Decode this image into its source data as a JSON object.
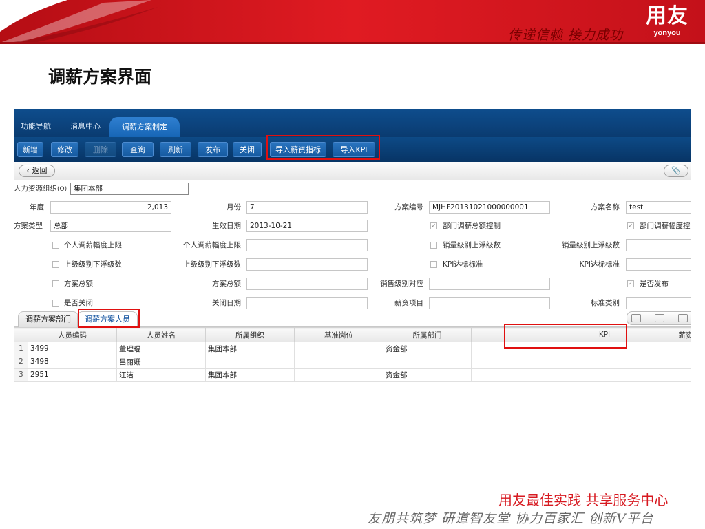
{
  "slide": {
    "slogan": "传递信赖 接力成功",
    "logo_cn": "用友",
    "logo_en": "yonyou",
    "title": "调薪方案界面",
    "footer_red": "用友最佳实践 共享服务中心",
    "footer_script": "友朋共筑梦 研道智友堂 协力百家汇 创新V平台"
  },
  "nav_tabs": [
    "功能导航",
    "消息中心",
    "调薪方案制定"
  ],
  "toolbar": {
    "new": "新增",
    "edit": "修改",
    "delete": "删除",
    "query": "查询",
    "refresh": "刷新",
    "publish": "发布",
    "close": "关闭",
    "import_salary": "导入薪资指标",
    "import_kpi": "导入KPI"
  },
  "subbar": {
    "back": "返回",
    "attach_icon": "paperclip-icon"
  },
  "form": {
    "org_label": "人力资源组织",
    "org_hint": "(O)",
    "org_value": "集团本部",
    "year_label": "年度",
    "year_value": "2,013",
    "month_label": "月份",
    "month_value": "7",
    "code_label": "方案编号",
    "code_value": "MJHF20131021000000001",
    "name_label": "方案名称",
    "name_value": "test",
    "type_label": "方案类型",
    "type_value": "总部",
    "effective_label": "生效日期",
    "effective_value": "2013-10-21",
    "dept_total_ctrl": "部门调薪总额控制",
    "dept_range_ctrl": "部门调薪幅度控制",
    "personal_upper": "个人调薪幅度上限",
    "personal_upper_label": "个人调薪幅度上限",
    "sales_up_float": "销量级别上浮级数",
    "sales_up_float_label": "销量级别上浮级数",
    "superior_down": "上级级别下浮级数",
    "superior_down_label": "上级级别下浮级数",
    "kpi_standard": "KPI达标标准",
    "kpi_standard_label": "KPI达标标准",
    "plan_total": "方案总额",
    "plan_total_label": "方案总额",
    "sales_level": "销售级别对应",
    "is_published": "是否发布",
    "is_closed": "是否关闭",
    "close_date_label": "关闭日期",
    "salary_item_label": "薪资项目",
    "standard_type_label": "标准类别"
  },
  "panel_tabs": [
    "调薪方案部门",
    "调薪方案人员"
  ],
  "grid": {
    "columns": [
      "人员编码",
      "人员姓名",
      "所属组织",
      "基准岗位",
      "所属部门",
      "",
      "KPI",
      "薪资指标",
      ""
    ],
    "rows": [
      {
        "idx": "1",
        "code": "3499",
        "name": "董理琨",
        "org": "集团本部",
        "post": "",
        "dept": "资金部"
      },
      {
        "idx": "2",
        "code": "3498",
        "name": "吕丽姗",
        "org": "",
        "post": "",
        "dept": ""
      },
      {
        "idx": "3",
        "code": "2951",
        "name": "汪洁",
        "org": "集团本部",
        "post": "",
        "dept": "资金部"
      }
    ]
  },
  "colors": {
    "banner_red": "#d4141c",
    "toolbar_blue": "#0a3b70",
    "highlight_red": "#e01010",
    "footer_red": "#d71920"
  }
}
